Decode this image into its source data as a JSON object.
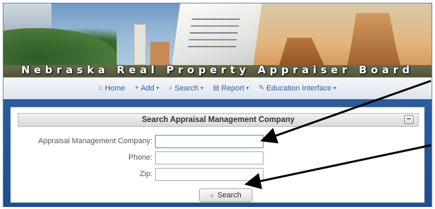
{
  "banner": {
    "title": "Nebraska Real Property Appraiser Board"
  },
  "nav": {
    "items": [
      {
        "label": "Home",
        "icon": "home-icon",
        "has_dropdown": false
      },
      {
        "label": "Add",
        "icon": "plus-icon",
        "has_dropdown": true
      },
      {
        "label": "Search",
        "icon": "search-icon",
        "has_dropdown": true
      },
      {
        "label": "Report",
        "icon": "report-icon",
        "has_dropdown": true
      },
      {
        "label": "Education Interface",
        "icon": "pencil-icon",
        "has_dropdown": true
      }
    ]
  },
  "panel": {
    "title": "Search Appraisal Management Company",
    "collapse_symbol": "−",
    "fields": [
      {
        "label": "Appraisal Management Company:",
        "value": "",
        "placeholder": ""
      },
      {
        "label": "Phone:",
        "value": "",
        "placeholder": ""
      },
      {
        "label": "Zip:",
        "value": "",
        "placeholder": ""
      }
    ],
    "search_button_label": "Search"
  },
  "colors": {
    "page_blue": "#1d4f8e",
    "nav_link": "#2b5fa8",
    "annotation_arrow": "#000000"
  }
}
